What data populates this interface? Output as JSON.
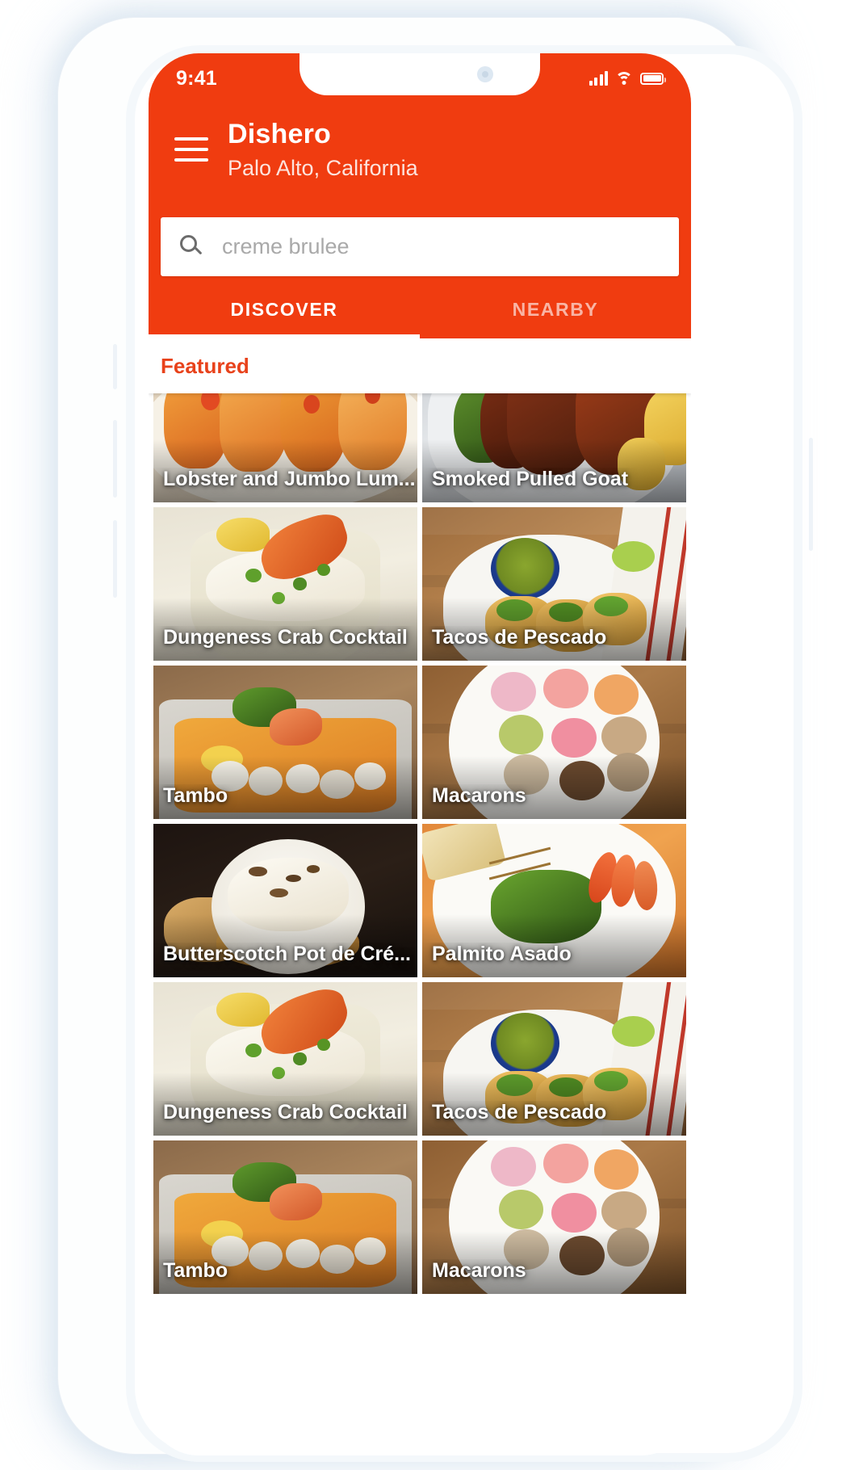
{
  "status_bar": {
    "time": "9:41",
    "icons": [
      "signal-icon",
      "wifi-icon",
      "battery-icon"
    ]
  },
  "header": {
    "menu_icon": "hamburger-menu-icon",
    "title": "Dishero",
    "subtitle": "Palo Alto, California",
    "accent_color": "#F03C10"
  },
  "search": {
    "icon": "search-icon",
    "placeholder": "creme brulee",
    "value": ""
  },
  "tabs": [
    {
      "label": "DISCOVER",
      "active": true
    },
    {
      "label": "NEARBY",
      "active": false
    }
  ],
  "section": {
    "featured_label": "Featured",
    "featured_color": "#E8421B"
  },
  "cards": [
    {
      "title": "Lobster and Jumbo Lum...",
      "art": "p-lobster"
    },
    {
      "title": "Smoked Pulled Goat",
      "art": "p-goat"
    },
    {
      "title": "Dungeness Crab Cocktail",
      "art": "p-crab"
    },
    {
      "title": "Tacos de Pescado",
      "art": "p-tacos"
    },
    {
      "title": "Tambo",
      "art": "p-tambo"
    },
    {
      "title": "Macarons",
      "art": "p-maca"
    },
    {
      "title": "Butterscotch Pot de Cré...",
      "art": "p-butter"
    },
    {
      "title": "Palmito Asado",
      "art": "p-palmito"
    },
    {
      "title": "Dungeness Crab Cocktail",
      "art": "p-crab"
    },
    {
      "title": "Tacos de Pescado",
      "art": "p-tacos"
    },
    {
      "title": "Tambo",
      "art": "p-tambo"
    },
    {
      "title": "Macarons",
      "art": "p-maca"
    }
  ]
}
